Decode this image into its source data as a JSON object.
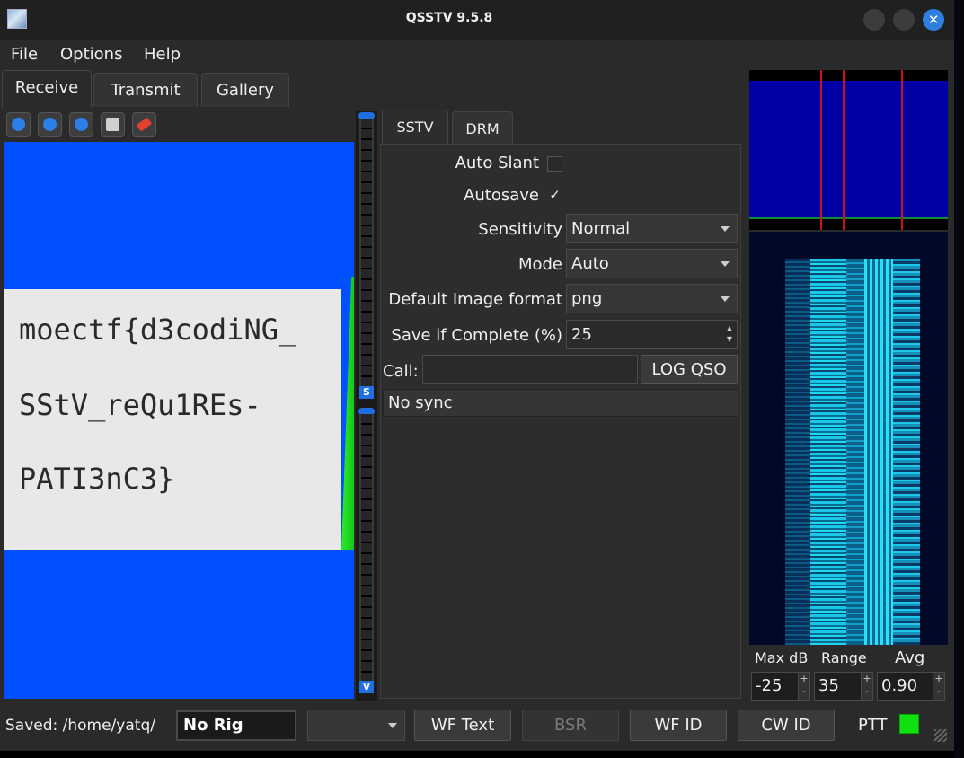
{
  "window": {
    "title": "QSSTV 9.5.8",
    "close_glyph": "✕"
  },
  "menu": [
    "File",
    "Options",
    "Help"
  ],
  "main_tabs": [
    "Receive",
    "Transmit",
    "Gallery"
  ],
  "toolbar": [
    "play-icon",
    "stop-icon",
    "refresh-icon",
    "save-icon",
    "eraser-icon"
  ],
  "rx_image": {
    "lines": [
      "moectf{d3codiNG_",
      "SStV_reQu1REs-",
      "PATI3nC3}"
    ]
  },
  "vu": {
    "top_label": "S",
    "bottom_label": "V"
  },
  "settings_tabs": [
    "SSTV",
    "DRM"
  ],
  "settings": {
    "auto_slant_label": "Auto Slant",
    "auto_slant_checked": false,
    "autosave_label": "Autosave",
    "autosave_mark": "✓",
    "sensitivity_label": "Sensitivity",
    "sensitivity_value": "Normal",
    "mode_label": "Mode",
    "mode_value": "Auto",
    "format_label": "Default Image format",
    "format_value": "png",
    "save_complete_label": "Save if Complete (%)",
    "save_complete_value": "25",
    "call_label": "Call:",
    "call_value": "",
    "log_qso": "LOG QSO",
    "status": "No sync"
  },
  "waterfall_controls": {
    "max_db_label": "Max dB",
    "range_label": "Range",
    "avg_label": "Avg",
    "max_db": "-25",
    "range": "35",
    "avg": "0.90",
    "plus": "+",
    "minus": "-"
  },
  "statusbar": {
    "saved": "Saved: /home/yatq/",
    "rig": "No Rig",
    "wf_text": "WF Text",
    "bsr": "BSR",
    "wf_id": "WF ID",
    "cw_id": "CW ID",
    "ptt": "PTT"
  },
  "colors": {
    "accent": "#2f7fe0",
    "ptt_led": "#10e010",
    "image_blue": "#0050ff"
  }
}
